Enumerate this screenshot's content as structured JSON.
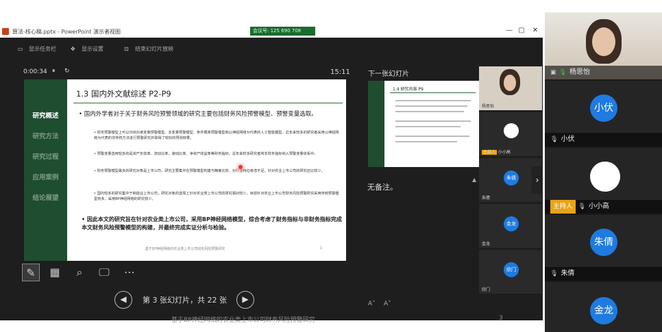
{
  "window": {
    "title": "算法-核心稿.pptx - PowerPoint 演示者视图",
    "meeting_badge": "会议号: 125 690 708",
    "controls": [
      "—",
      "▢",
      "✕"
    ]
  },
  "toolbar": {
    "show_taskbar": "显示任务栏",
    "display_settings": "显示设置",
    "end_show": "结束幻灯片放映"
  },
  "timer": {
    "elapsed": "0:00:34",
    "pause_icon": "⏸",
    "reset_icon": "↻",
    "clock": "15:11"
  },
  "slide": {
    "nav": [
      "研究概述",
      "研究方法",
      "研究过程",
      "应用案例",
      "结论展望"
    ],
    "title": "1.3 国内外文献综述     P2-P9",
    "intro": "国内外学者对于关于财务风险预警领域的研究主要包括财务风险预警模型、预警变量选取。",
    "subs": [
      "财务预警模型上可以归纳为单变量预警模型、多变量预警模型、条件概率预警模型和以神经网络为代表的人工智能模型。近年来较多的研究者采用以神经网络为代表的非传统方法进行预警研究并取得了较好的预测效果。",
      "预警变量选用较多的是资产负债率、流动比率、速动比率、净资产收益率等财务指标，近年来较多研究者将非财务指标纳入预警变量体系中。",
      "财务预警模型最多的研究对象是上市公司，研究主要集中在预警模型构建与精度比较，对行业特征考虑不足，针对农业上市公司的研究还比较少。",
      "国内较多的研究集中于制造业上市公司，研究对象的选择上针对农业类上市公司的研究相对较少，目前针对农业上市公司财务风险预警研究采用传统预警模型较多，采用BP神经网络的研究较少。"
    ],
    "conclusion": "因此本文的研究旨在针对农业类上市公司，采用BP神经网络模型，综合考虑了财务指标与非财务指标完成本文财务风险预警模型的构建，并最终完成实证分析与检验。",
    "footer": "基于BP神经网络的农业类上市公司财务风险预警研究",
    "page_no": "1"
  },
  "slide_counter": "第 3 张幻灯片，共 22 张",
  "next_slide": {
    "label": "下一张幻灯片",
    "title": "1.4 研究内容    P9"
  },
  "notes": "无备注。",
  "below_window": {
    "text": "基于BP神经网络的农业类上市公司财务风险预警研究",
    "num": "3"
  },
  "mini_participants": [
    {
      "name": "杨思怡"
    },
    {
      "host": "主持人",
      "name": "小小高"
    },
    {
      "name": "朱倩",
      "avatar": "朱倩"
    },
    {
      "name": "金龙",
      "avatar": "金龙"
    },
    {
      "name": "欣门",
      "avatar": "欣门"
    }
  ],
  "participants": [
    {
      "name": "杨思怡"
    },
    {
      "avatar": "小伏",
      "name": "小伏"
    },
    {
      "host": "主持人",
      "name": "小小高"
    },
    {
      "avatar": "朱倩",
      "name": "朱倩"
    },
    {
      "avatar": "金龙",
      "name": ""
    }
  ],
  "colors": {
    "slide_sidebar": "#1f4d2f",
    "avatar_blue": "#1e7be0",
    "host_badge": "#e8a317"
  }
}
